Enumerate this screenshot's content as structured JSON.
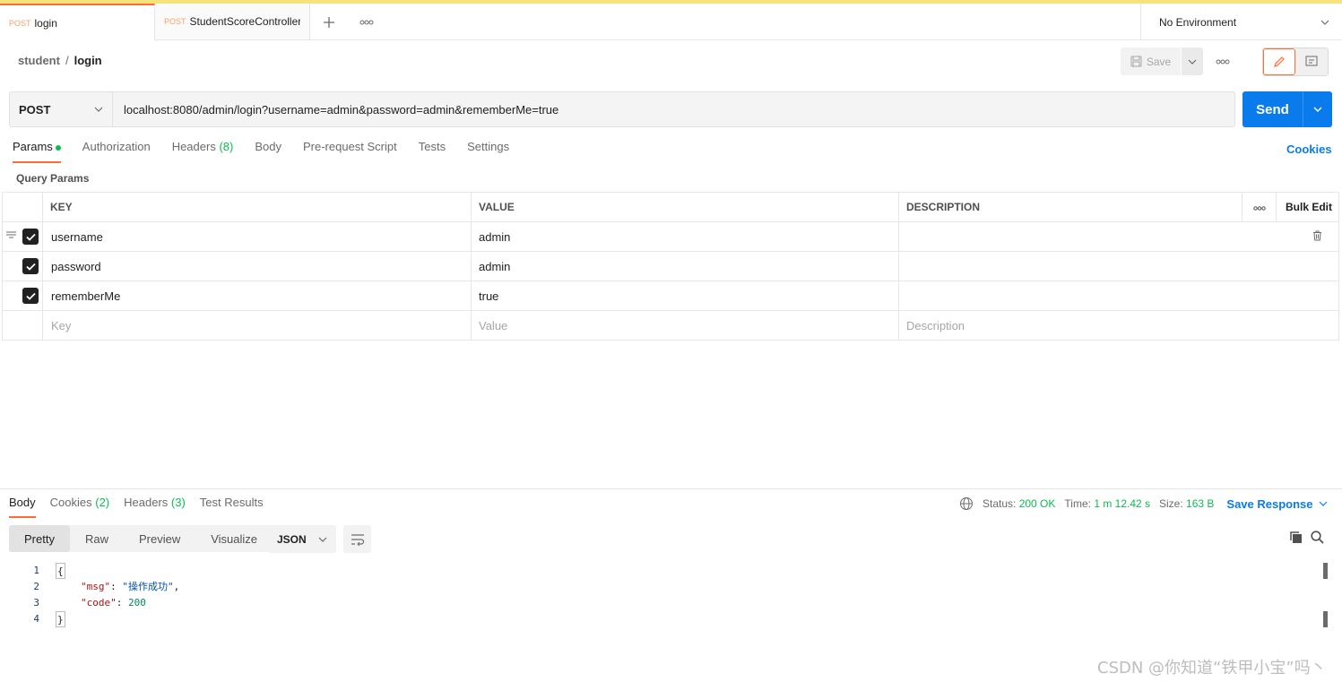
{
  "tabs": [
    {
      "method": "POST",
      "title": "login"
    },
    {
      "method": "POST",
      "title": "StudentScoreController"
    }
  ],
  "environment": "No Environment",
  "breadcrumb": {
    "parent": "student",
    "separator": "/",
    "current": "login"
  },
  "toolbar": {
    "save_label": "Save"
  },
  "request": {
    "method": "POST",
    "url": "localhost:8080/admin/login?username=admin&password=admin&rememberMe=true",
    "send_label": "Send"
  },
  "request_tabs": {
    "params": "Params",
    "authorization": "Authorization",
    "headers": "Headers",
    "headers_count": "(8)",
    "body": "Body",
    "pre_request": "Pre-request Script",
    "tests": "Tests",
    "settings": "Settings",
    "cookies": "Cookies"
  },
  "query_params": {
    "label": "Query Params",
    "headers": {
      "key": "KEY",
      "value": "VALUE",
      "description": "DESCRIPTION",
      "bulk_edit": "Bulk Edit"
    },
    "rows": [
      {
        "key": "username",
        "value": "admin",
        "checked": true
      },
      {
        "key": "password",
        "value": "admin",
        "checked": true
      },
      {
        "key": "rememberMe",
        "value": "true",
        "checked": true
      }
    ],
    "placeholders": {
      "key": "Key",
      "value": "Value",
      "description": "Description"
    }
  },
  "response": {
    "tabs": {
      "body": "Body",
      "cookies": "Cookies",
      "cookies_count": "(2)",
      "headers": "Headers",
      "headers_count": "(3)",
      "test_results": "Test Results"
    },
    "status_label": "Status:",
    "status": "200 OK",
    "time_label": "Time:",
    "time": "1 m 12.42 s",
    "size_label": "Size:",
    "size": "163 B",
    "save_response": "Save Response",
    "views": [
      "Pretty",
      "Raw",
      "Preview",
      "Visualize"
    ],
    "format": "JSON",
    "code_lines": {
      "l1": "{",
      "l2_key": "\"msg\"",
      "l2_val": "\"操作成功\"",
      "l3_key": "\"code\"",
      "l3_val": "200",
      "l4": "}"
    }
  },
  "watermark": "CSDN @你知道“铁甲小宝”吗丶",
  "colors": {
    "accent": "#ff6c37",
    "primary": "#097bed",
    "success": "#0cbb52"
  }
}
